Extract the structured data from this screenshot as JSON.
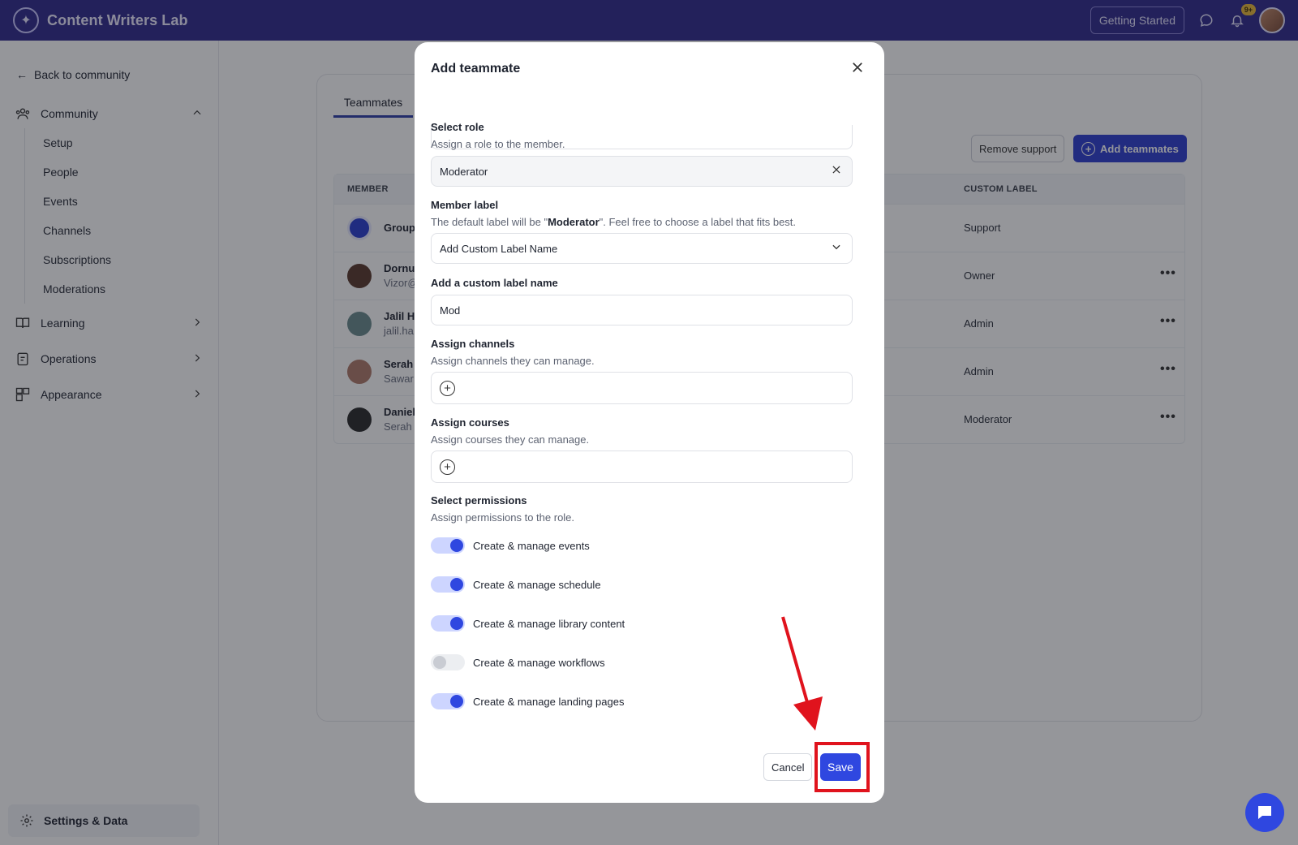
{
  "app": {
    "name": "Content Writers Lab",
    "getting_started": "Getting Started",
    "notification_badge": "9+"
  },
  "sidebar": {
    "back": "Back to community",
    "groups": [
      {
        "label": "Community",
        "icon": "community-icon",
        "expanded": true
      },
      {
        "label": "Learning",
        "icon": "book-icon"
      },
      {
        "label": "Operations",
        "icon": "operations-icon"
      },
      {
        "label": "Appearance",
        "icon": "appearance-icon"
      }
    ],
    "community_items": [
      "Setup",
      "People",
      "Events",
      "Channels",
      "Subscriptions",
      "Moderations"
    ],
    "settings": "Settings & Data"
  },
  "main": {
    "tab": "Teammates",
    "remove_support": "Remove support",
    "add_teammates": "Add teammates",
    "columns": {
      "member": "MEMBER",
      "custom_label": "CUSTOM LABEL"
    },
    "rows": [
      {
        "name": "Group",
        "email": "",
        "label": "Support",
        "menu": false
      },
      {
        "name": "Dornu",
        "email": "Vizor@",
        "label": "Owner",
        "menu": true
      },
      {
        "name": "Jalil H",
        "email": "jalil.ha",
        "label": "Admin",
        "menu": true
      },
      {
        "name": "Serah",
        "email": "Sawar",
        "label": "Admin",
        "menu": true
      },
      {
        "name": "Daniel",
        "email": "Serah",
        "label": "Moderator",
        "menu": true
      }
    ]
  },
  "modal": {
    "title": "Add teammate",
    "select_role": {
      "label": "Select role",
      "help": "Assign a role to the member.",
      "value": "Moderator"
    },
    "member_label": {
      "label": "Member label",
      "help_prefix": "The default label will be \"",
      "help_role": "Moderator",
      "help_suffix": "\". Feel free to choose a label that fits best.",
      "value": "Add Custom Label Name"
    },
    "custom_label": {
      "label": "Add a custom label name",
      "value": "Mod"
    },
    "channels": {
      "label": "Assign channels",
      "help": "Assign channels they can manage."
    },
    "courses": {
      "label": "Assign courses",
      "help": "Assign courses they can manage."
    },
    "permissions": {
      "label": "Select permissions",
      "help": "Assign permissions to the role.",
      "items": [
        {
          "label": "Create & manage events",
          "on": true
        },
        {
          "label": "Create & manage schedule",
          "on": true
        },
        {
          "label": "Create & manage library content",
          "on": true
        },
        {
          "label": "Create & manage workflows",
          "on": false
        },
        {
          "label": "Create & manage landing pages",
          "on": true
        }
      ]
    },
    "cancel": "Cancel",
    "save": "Save"
  },
  "colors": {
    "topbar": "#302a8c",
    "primary": "#2f47e0",
    "annotation": "#e0131d"
  }
}
